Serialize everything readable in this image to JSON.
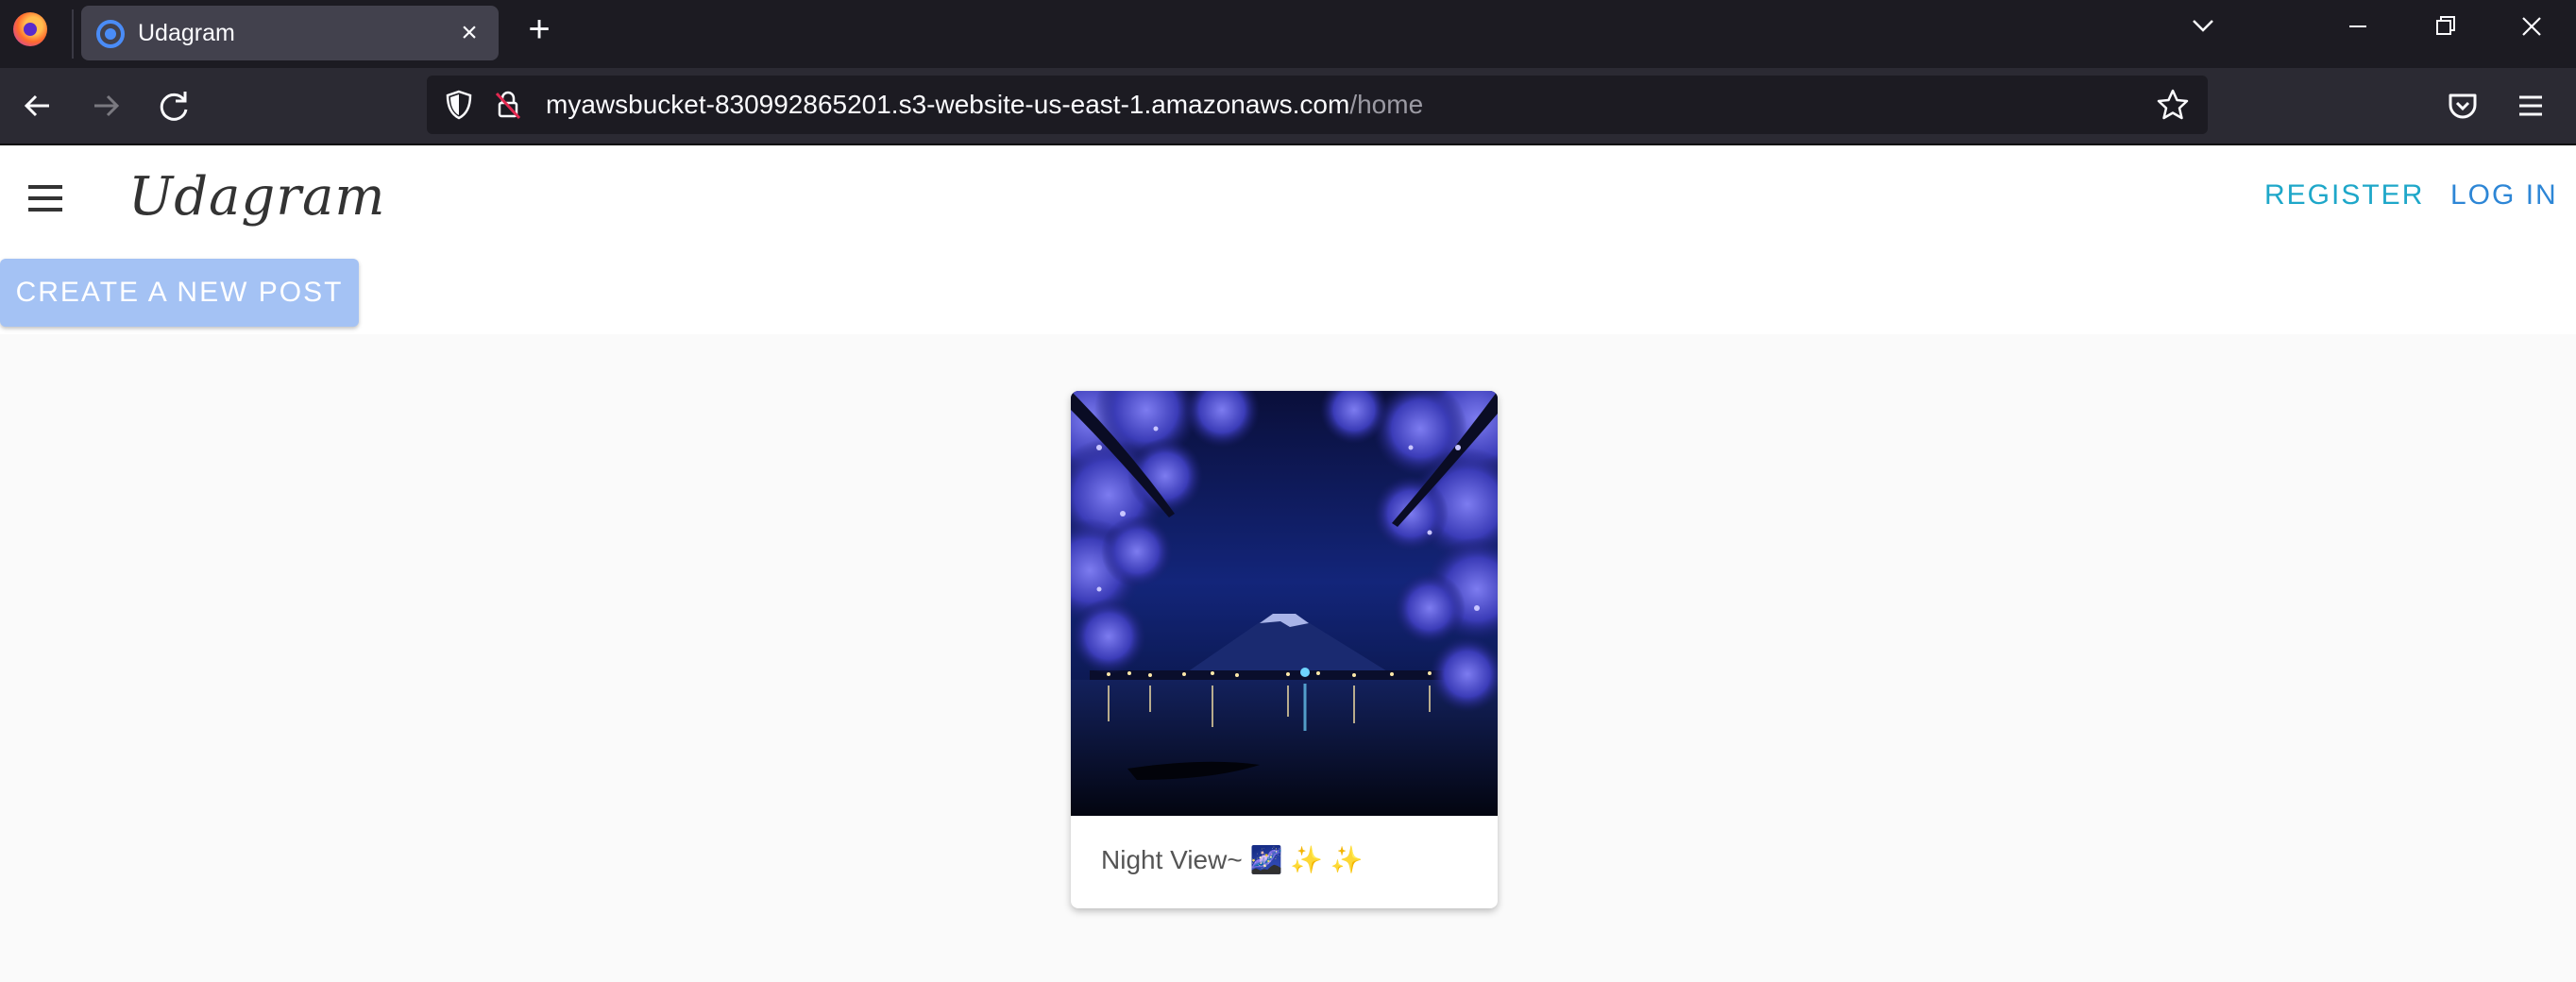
{
  "browser": {
    "tab": {
      "title": "Udagram",
      "close_glyph": "×"
    },
    "new_tab_glyph": "+",
    "url": {
      "host": "myawsbucket-830992865201.s3-website-us-east-1.amazonaws.com",
      "path": "/home"
    },
    "icons": [
      "firefox-logo",
      "tab-list-chevron",
      "minimize",
      "restore",
      "close-window",
      "back",
      "forward",
      "reload",
      "tracking-shield",
      "insecure-lock",
      "bookmark-star",
      "pocket",
      "app-menu"
    ]
  },
  "app": {
    "logo": "Udagram",
    "nav": {
      "register": "REGISTER",
      "login": "LOG IN"
    },
    "create_post_label": "CREATE A NEW POST",
    "colors": {
      "register": "#1ea7c9",
      "login": "#2d86d6",
      "create_button": "#a4c2f4"
    }
  },
  "feed": {
    "posts": [
      {
        "caption": "Night View~ 🌌 ✨ ✨",
        "image": "night-view-cherry-blossoms-mountain-lake"
      }
    ]
  }
}
